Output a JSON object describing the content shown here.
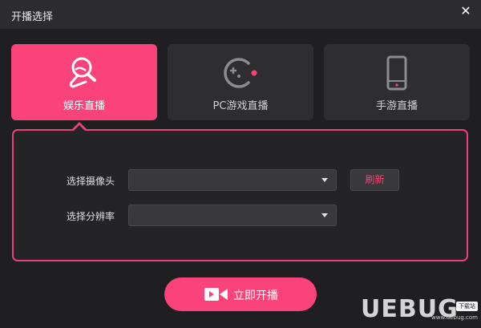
{
  "window": {
    "title": "开播选择",
    "close_glyph": "✕"
  },
  "modes": [
    {
      "label": "娱乐直播",
      "icon": "microphone-icon",
      "active": true
    },
    {
      "label": "PC游戏直播",
      "icon": "pacman-icon",
      "active": false
    },
    {
      "label": "手游直播",
      "icon": "phone-icon",
      "active": false
    }
  ],
  "form": {
    "camera_label": "选择摄像头",
    "camera_value": "",
    "resolution_label": "选择分辨率",
    "resolution_value": "",
    "refresh_label": "刷新"
  },
  "start_button": {
    "label": "立即开播",
    "icon": "video-camera-icon"
  },
  "watermark": {
    "text": "UEBUG",
    "badge": "下载站",
    "domain": "www.uebug.com"
  },
  "colors": {
    "accent": "#f9437a",
    "background": "#1f1f21",
    "titlebar": "#2c2c2e",
    "card": "#2e2e31"
  }
}
